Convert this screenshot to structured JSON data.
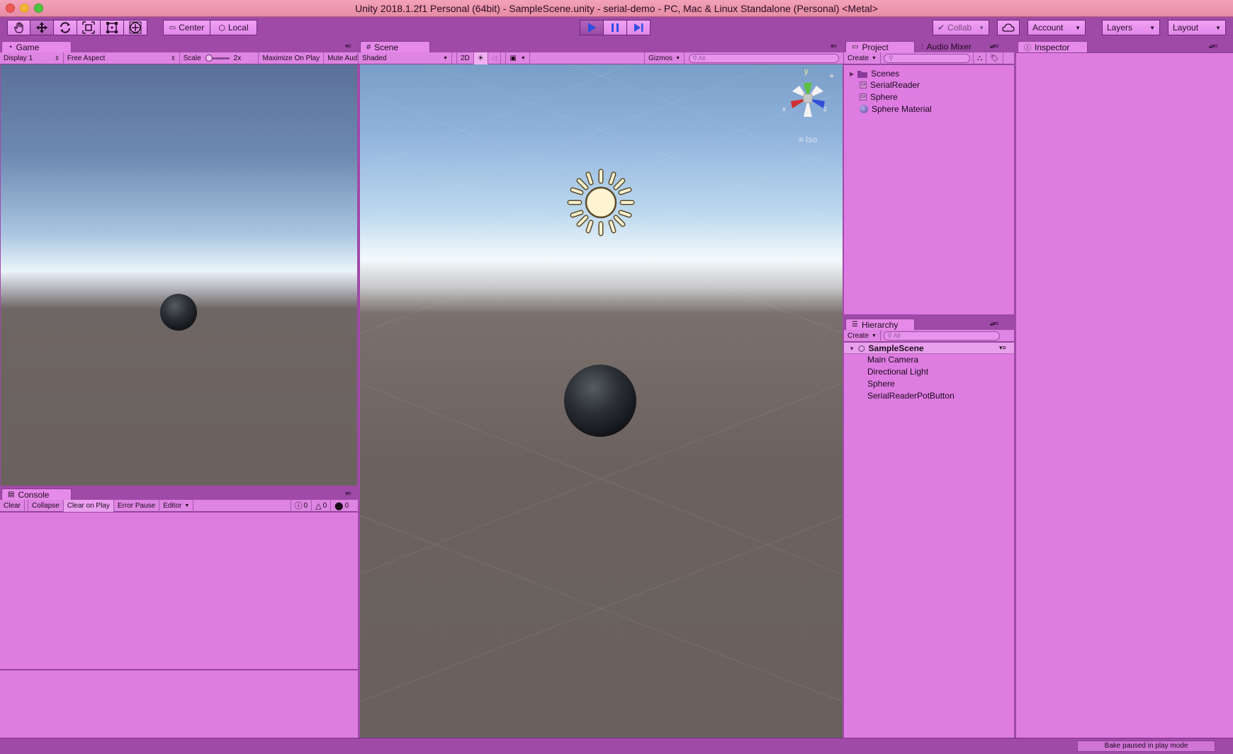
{
  "window": {
    "title": "Unity 2018.1.2f1 Personal (64bit) - SampleScene.unity - serial-demo - PC, Mac & Linux Standalone (Personal) <Metal>"
  },
  "toolbar": {
    "tools": [
      "hand-tool-icon",
      "move-tool-icon",
      "rotate-tool-icon",
      "scale-tool-icon",
      "rect-tool-icon",
      "transform-tool-icon"
    ],
    "pivot": {
      "center": "Center",
      "local": "Local"
    },
    "collab": "Collab",
    "account": "Account",
    "layers": "Layers",
    "layout": "Layout"
  },
  "game": {
    "tab": "Game",
    "display": "Display 1",
    "aspect": "Free Aspect",
    "scale_label": "Scale",
    "scale_value": "2x",
    "maximize": "Maximize On Play",
    "mute": "Mute Aud"
  },
  "console": {
    "tab": "Console",
    "clear": "Clear",
    "collapse": "Collapse",
    "clear_on_play": "Clear on Play",
    "error_pause": "Error Pause",
    "editor": "Editor",
    "log_count": "0",
    "warn_count": "0",
    "error_count": "0"
  },
  "scene": {
    "tab": "Scene",
    "shading": "Shaded",
    "mode_2d": "2D",
    "gizmos": "Gizmos",
    "search_placeholder": "All",
    "iso": "Iso",
    "axis_y": "y",
    "axis_x": "x",
    "axis_z": "z"
  },
  "project": {
    "tab": "Project",
    "tab2": "Audio Mixer",
    "create": "Create",
    "items": [
      {
        "label": "Scenes",
        "icon": "folder-icon"
      },
      {
        "label": "SerialReader",
        "icon": "cs-script-icon"
      },
      {
        "label": "Sphere",
        "icon": "cs-script-icon"
      },
      {
        "label": "Sphere Material",
        "icon": "material-icon"
      }
    ],
    "cs_badge": "C#"
  },
  "hierarchy": {
    "tab": "Hierarchy",
    "create": "Create",
    "search_placeholder": "All",
    "scene": "SampleScene",
    "items": [
      "Main Camera",
      "Directional Light",
      "Sphere",
      "SerialReaderPotButton"
    ]
  },
  "inspector": {
    "tab": "Inspector"
  },
  "status": {
    "message": "Bake paused in play mode"
  },
  "colors": {
    "play_tint": "#a04aa8",
    "panel": "#de7ce2",
    "accent_blue": "#2f4fe0"
  }
}
